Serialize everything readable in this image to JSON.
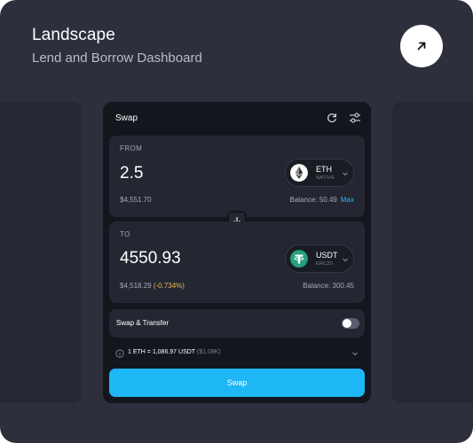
{
  "card": {
    "title": "Landscape",
    "subtitle": "Lend and Borrow Dashboard"
  },
  "widget": {
    "title": "Swap",
    "from": {
      "label": "FROM",
      "amount": "2.5",
      "fiat": "$4,551.70",
      "balance": "Balance: 50.49",
      "max_label": "Max",
      "token": {
        "symbol": "ETH",
        "network": "NATIVE",
        "icon": "ethereum-icon"
      }
    },
    "to": {
      "label": "TO",
      "amount": "4550.93",
      "fiat": "$4,518.29",
      "change": "(-0.734%)",
      "balance": "Balance: 300.45",
      "token": {
        "symbol": "USDT",
        "network": "ERC20",
        "icon": "tether-icon"
      }
    },
    "transfer": {
      "label": "Swap & Transfer",
      "enabled": false
    },
    "rate": {
      "text": "1 ETH = 1,086.97 USDT",
      "usd": "($1.09K)"
    },
    "swap_button": "Swap"
  },
  "colors": {
    "card_bg": "#2d303c",
    "widget_bg": "#14161d",
    "panel_bg": "#242732",
    "accent": "#1db7f5",
    "negative": "#e9b84a",
    "tether": "#26a17b"
  }
}
